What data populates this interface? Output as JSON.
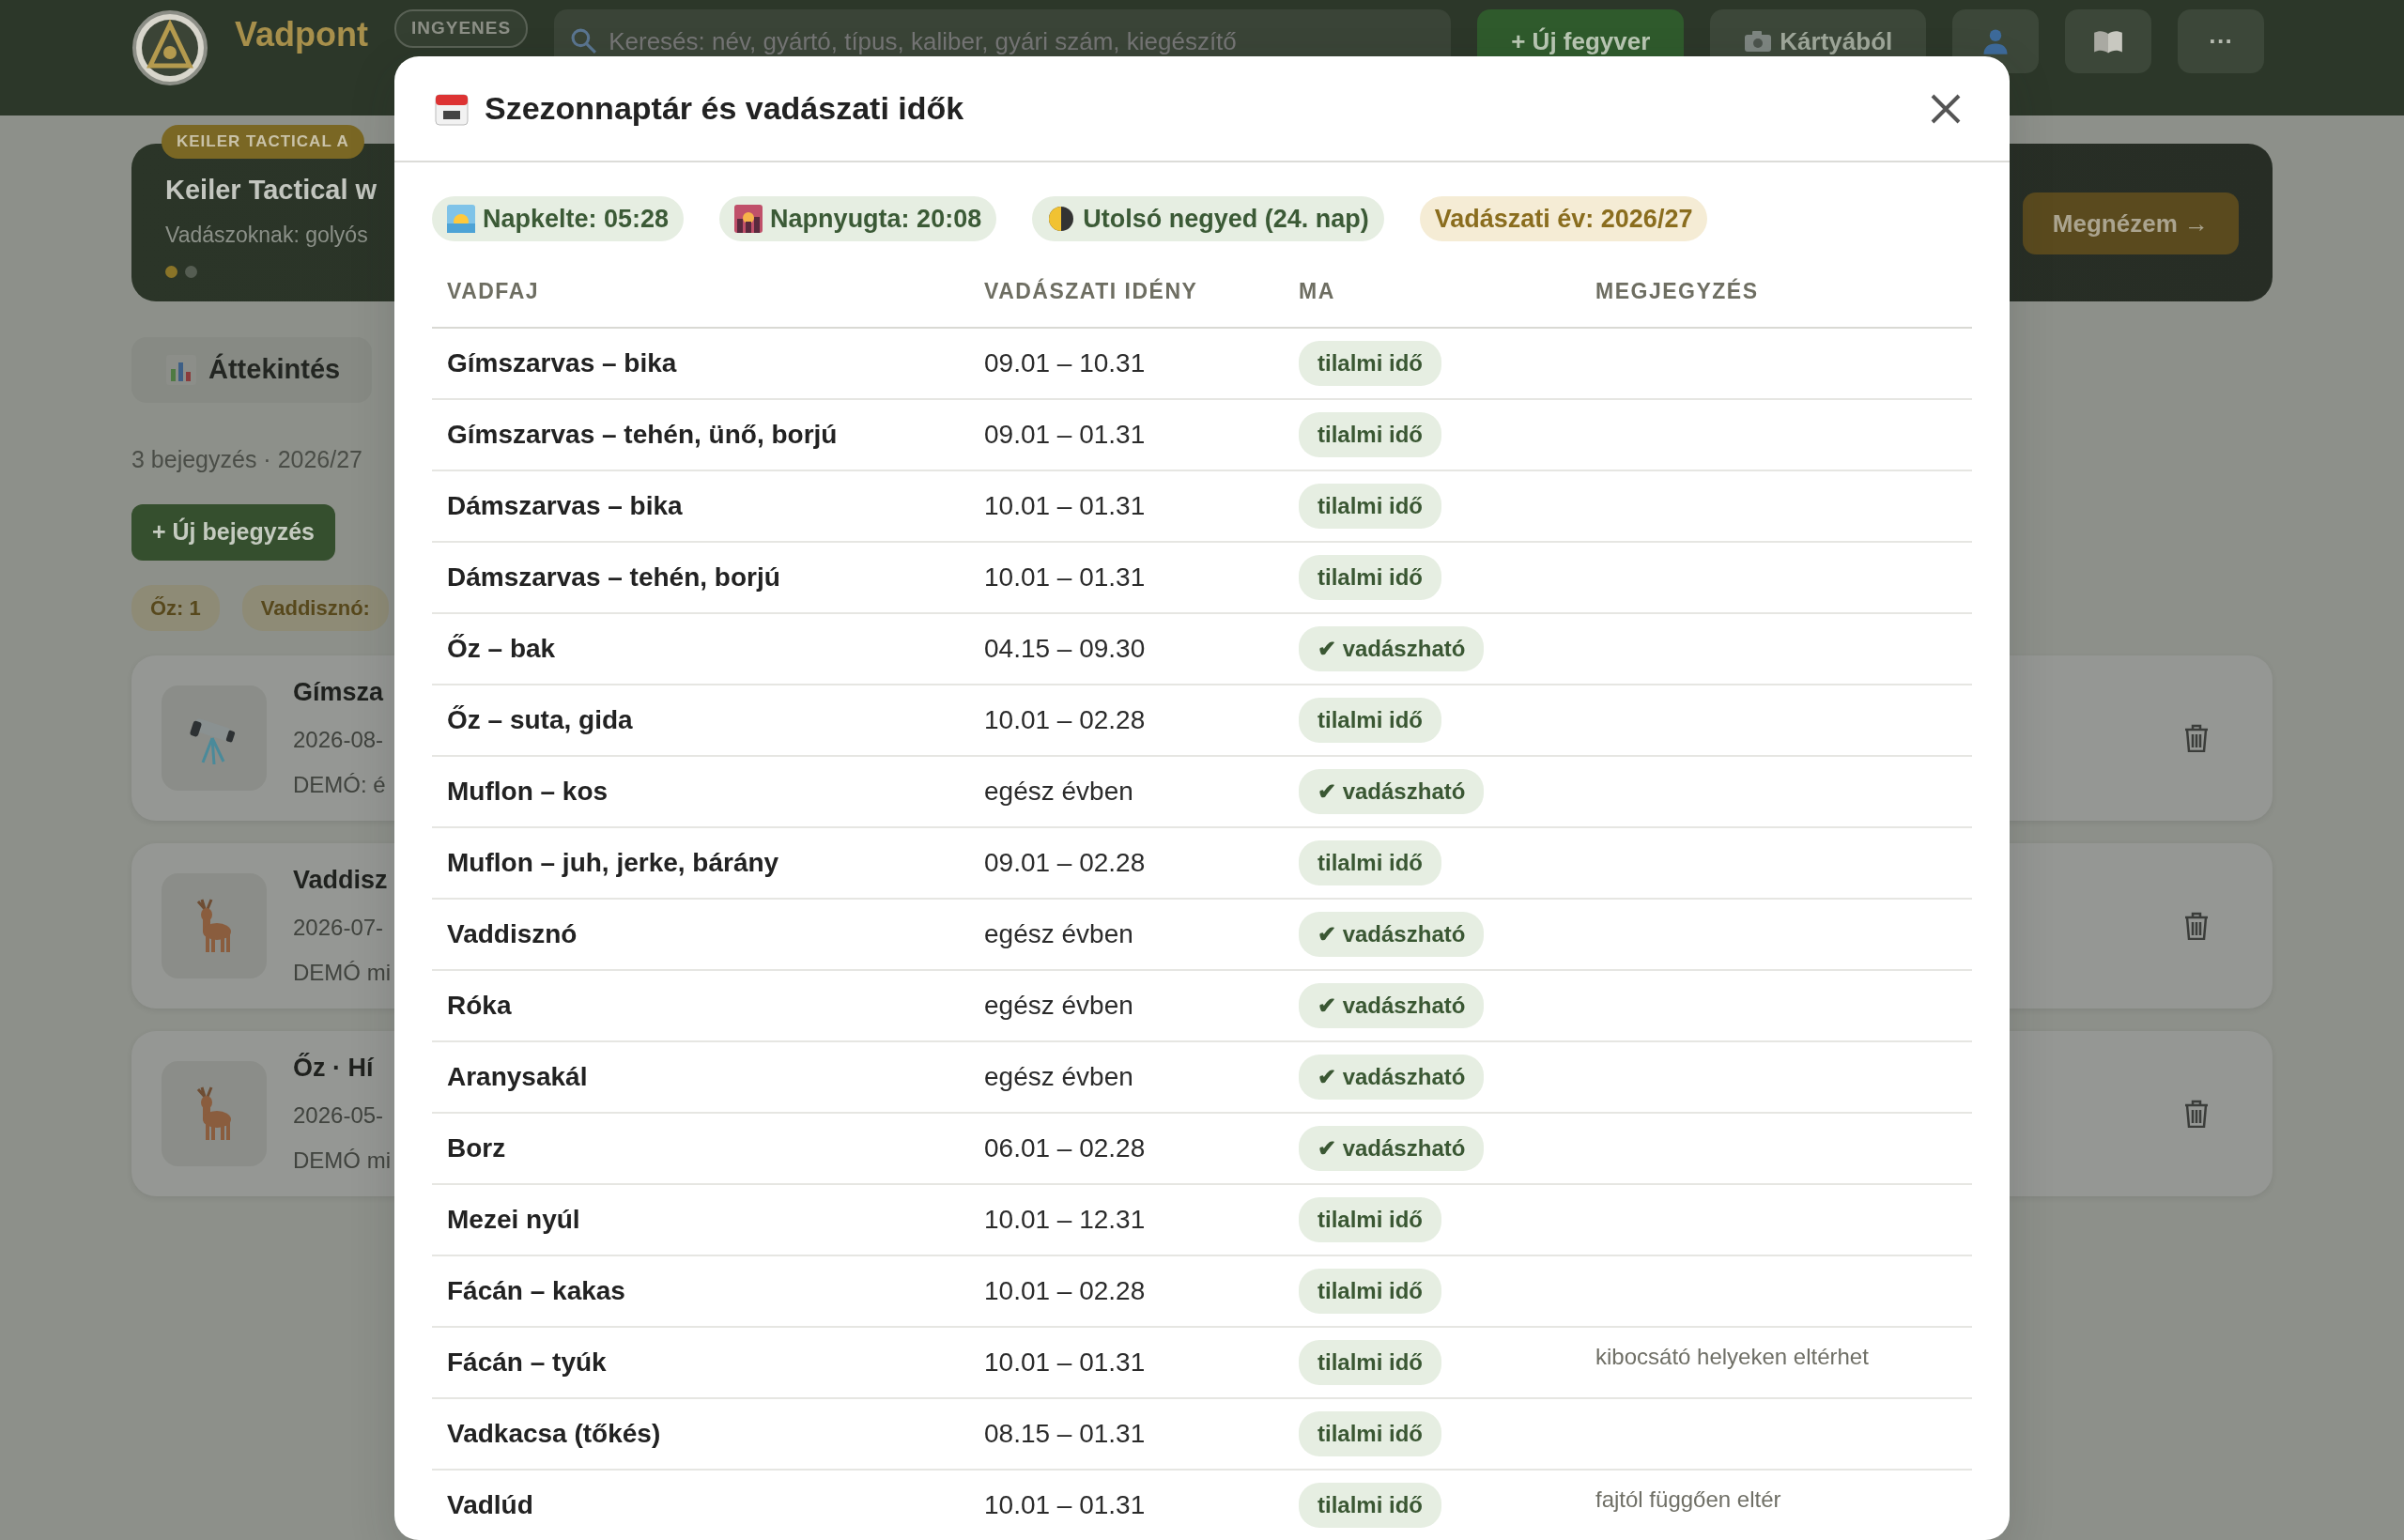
{
  "header": {
    "logo_text": "Vadpont",
    "plan_badge": "INGYENES",
    "search": {
      "placeholder": "Keresés: név, gyártó, típus, kaliber, gyári szám, kiegészítő"
    },
    "buttons": [
      {
        "kind": "primary",
        "label": "+ Új fegyver"
      },
      {
        "kind": "camera",
        "label": "Kártyából"
      }
    ],
    "icon_buttons": [
      {
        "kind": "user"
      },
      {
        "kind": "book"
      },
      {
        "kind": "more",
        "label": "···"
      }
    ]
  },
  "banner": {
    "badge": "KEILER TACTICAL A",
    "title": "Keiler Tactical w",
    "subtitle": "Vadászoknak: golyós",
    "dots": [
      {
        "selected": true
      },
      {
        "selected": false
      }
    ],
    "button": "Megnézem →"
  },
  "tabs": [
    {
      "label": "Áttekintés"
    }
  ],
  "summary": "3 bejegyzés · 2026/27",
  "actions": [
    "+ Új bejegyzés"
  ],
  "chips": [
    "Őz: 1",
    "Vaddisznó:"
  ],
  "entries": [
    {
      "kind": "telescope",
      "title": "Gímsza",
      "date": "2026-08-",
      "note": "DEMÓ: é"
    },
    {
      "kind": "deer",
      "title": "Vaddisz",
      "date": "2026-07-",
      "note": "DEMÓ mi"
    },
    {
      "kind": "deer",
      "title": "Őz · Hí",
      "date": "2026-05-",
      "note": "DEMÓ mi"
    }
  ],
  "modal": {
    "title": "Szezonnaptár és vadászati idők",
    "info_chips": [
      {
        "kind": "sunrise",
        "label": "Napkelte: 05:28"
      },
      {
        "kind": "sunset",
        "label": "Napnyugta: 20:08"
      },
      {
        "kind": "moon",
        "label": "Utolsó negyed (24. nap)"
      },
      {
        "kind": "year",
        "label": "Vadászati év: 2026/27"
      }
    ],
    "table": {
      "columns": [
        "VADFAJ",
        "VADÁSZATI IDÉNY",
        "MA",
        "MEGJEGYZÉS"
      ],
      "rows": [
        {
          "species": "Gímszarvas – bika",
          "season": "09.01 – 10.31",
          "today": "tilalmi idő"
        },
        {
          "species": "Gímszarvas – tehén, ünő, borjú",
          "season": "09.01 – 01.31",
          "today": "tilalmi idő"
        },
        {
          "species": "Dámszarvas – bika",
          "season": "10.01 – 01.31",
          "today": "tilalmi idő"
        },
        {
          "species": "Dámszarvas – tehén, borjú",
          "season": "10.01 – 01.31",
          "today": "tilalmi idő"
        },
        {
          "species": "Őz – bak",
          "season": "04.15 – 09.30",
          "today": "✔ vadászható"
        },
        {
          "species": "Őz – suta, gida",
          "season": "10.01 – 02.28",
          "today": "tilalmi idő"
        },
        {
          "species": "Muflon – kos",
          "season": "egész évben",
          "today": "✔ vadászható"
        },
        {
          "species": "Muflon – juh, jerke, bárány",
          "season": "09.01 – 02.28",
          "today": "tilalmi idő"
        },
        {
          "species": "Vaddisznó",
          "season": "egész évben",
          "today": "✔ vadászható"
        },
        {
          "species": "Róka",
          "season": "egész évben",
          "today": "✔ vadászható"
        },
        {
          "species": "Aranysakál",
          "season": "egész évben",
          "today": "✔ vadászható"
        },
        {
          "species": "Borz",
          "season": "06.01 – 02.28",
          "today": "✔ vadászható"
        },
        {
          "species": "Mezei nyúl",
          "season": "10.01 – 12.31",
          "today": "tilalmi idő"
        },
        {
          "species": "Fácán – kakas",
          "season": "10.01 – 02.28",
          "today": "tilalmi idő"
        },
        {
          "species": "Fácán – tyúk",
          "season": "10.01 – 01.31",
          "today": "tilalmi idő",
          "note": "kibocsátó helyeken eltérhet"
        },
        {
          "species": "Vadkacsa (tőkés)",
          "season": "08.15 – 01.31",
          "today": "tilalmi idő"
        },
        {
          "species": "Vadlúd",
          "season": "10.01 – 01.31",
          "today": "tilalmi idő",
          "note": "fajtól függően eltér"
        }
      ]
    }
  }
}
